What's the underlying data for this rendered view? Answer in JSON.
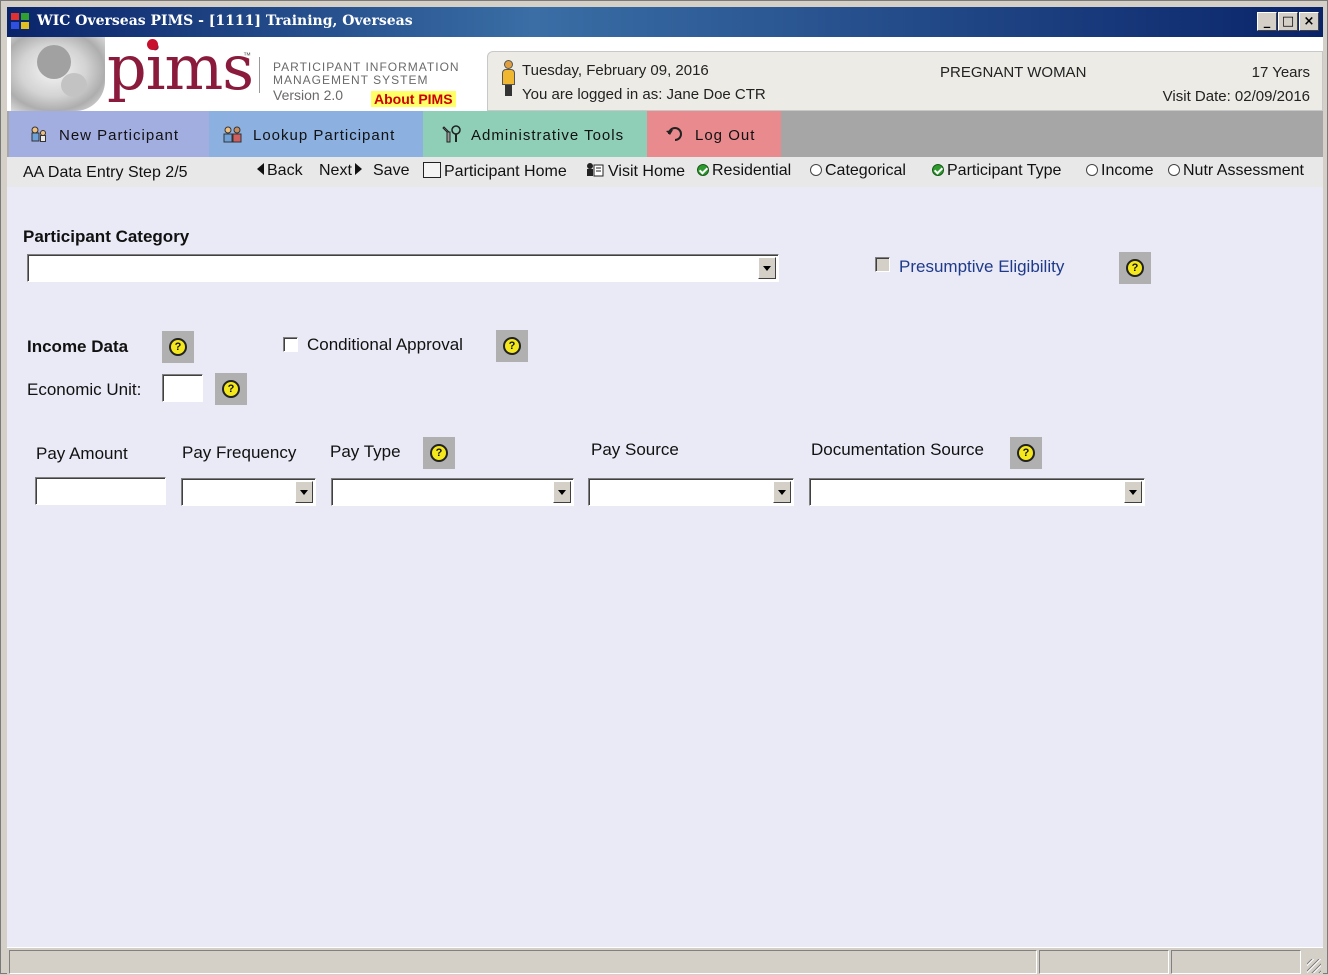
{
  "window": {
    "title": "WIC Overseas PIMS - [1111] Training, Overseas",
    "controls": {
      "minimize": "_",
      "maximize": "□",
      "close": "×"
    }
  },
  "header": {
    "logo_text": "pims",
    "logo_tm": "™",
    "system_name_line1": "PARTICIPANT INFORMATION",
    "system_name_line2": "MANAGEMENT SYSTEM",
    "version": "Version 2.0",
    "about_link": "About PIMS",
    "date": "Tuesday, February 09, 2016",
    "login": "You are logged in as: Jane Doe CTR",
    "participant_category": "PREGNANT WOMAN",
    "age": "17 Years",
    "visit_date": "Visit Date: 02/09/2016"
  },
  "tabs": [
    {
      "label": "New Participant",
      "icon": "new-participant-icon"
    },
    {
      "label": "Lookup Participant",
      "icon": "lookup-participant-icon"
    },
    {
      "label": "Administrative Tools",
      "icon": "admin-tools-icon"
    },
    {
      "label": "Log Out",
      "icon": "logout-icon"
    }
  ],
  "stepbar": {
    "step": "AA Data Entry Step 2/5",
    "back": "Back",
    "next": "Next",
    "save": "Save",
    "participant_home": "Participant Home",
    "visit_home": "Visit Home",
    "steps": [
      {
        "label": "Residential",
        "done": true
      },
      {
        "label": "Categorical",
        "done": false
      },
      {
        "label": "Participant Type",
        "done": true
      },
      {
        "label": "Income",
        "done": false
      },
      {
        "label": "Nutr Assessment",
        "done": false
      }
    ]
  },
  "form": {
    "participant_category_label": "Participant Category",
    "participant_category_value": "",
    "presumptive_eligibility_label": "Presumptive Eligibility",
    "income_data_label": "Income Data",
    "conditional_approval_label": "Conditional Approval",
    "economic_unit_label": "Economic Unit:",
    "economic_unit_value": "",
    "help_glyph": "?",
    "columns": {
      "pay_amount": "Pay Amount",
      "pay_frequency": "Pay Frequency",
      "pay_type": "Pay Type",
      "pay_source": "Pay Source",
      "documentation_source": "Documentation Source"
    }
  },
  "colors": {
    "titlebar": "#0a246a",
    "tab_new": "#a2aee0",
    "tab_lookup": "#8cb0e0",
    "tab_admin": "#8fcfb8",
    "tab_logout": "#e98a8e",
    "content_bg": "#e9eaf6",
    "presumptive_label": "#1f3a8a"
  }
}
